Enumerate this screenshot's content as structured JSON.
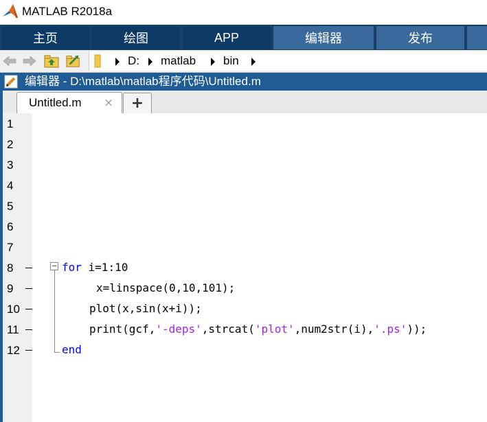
{
  "window": {
    "title": "MATLAB R2018a"
  },
  "toolstrip": {
    "tabs": [
      {
        "label": "主页"
      },
      {
        "label": "绘图"
      },
      {
        "label": "APP"
      },
      {
        "label": "编辑器"
      },
      {
        "label": "发布"
      }
    ]
  },
  "address": {
    "crumbs": [
      "D:",
      "matlab",
      "bin"
    ]
  },
  "editor": {
    "header_title": "编辑器 - D:\\matlab\\matlab程序代码\\Untitled.m",
    "active_tab": "Untitled.m",
    "close_glyph": "×",
    "new_tab_glyph": "+"
  },
  "code": {
    "line_numbers": [
      "1",
      "2",
      "3",
      "4",
      "5",
      "6",
      "7",
      "8",
      "9",
      "10",
      "11",
      "12"
    ],
    "line8": {
      "kw": "for",
      "rest": " i=1:10"
    },
    "line9": "x=linspace(0,10,101);",
    "line10": "plot(x,sin(x+i));",
    "line11": {
      "p1": "print(gcf,",
      "s1": "'-deps'",
      "p2": ",strcat(",
      "s2": "'plot'",
      "p3": ",num2str(i),",
      "s3": "'.ps'",
      "p4": "));"
    },
    "line12": {
      "kw": "end"
    }
  }
}
